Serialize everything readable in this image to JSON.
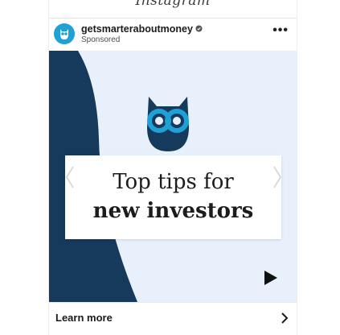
{
  "app": {
    "title": "Instagram"
  },
  "post": {
    "username": "getsmarteraboutmoney",
    "sponsored_label": "Sponsored",
    "more_label": "•••",
    "avatar_icon": "owl-logo-icon",
    "verified_icon": "verified-badge-icon"
  },
  "media": {
    "line1": "Top tips for",
    "line2": "new investors",
    "icons": [
      "owl-icon",
      "play-icon",
      "chevron-left-icon",
      "chevron-right-icon"
    ]
  },
  "cta": {
    "label": "Learn more",
    "icon": "chevron-right-icon"
  },
  "colors": {
    "navy": "#163a5c",
    "light_blue_bg": "#e7f0fb",
    "accent_cyan": "#1da1d6",
    "text": "#1b1b1b"
  }
}
